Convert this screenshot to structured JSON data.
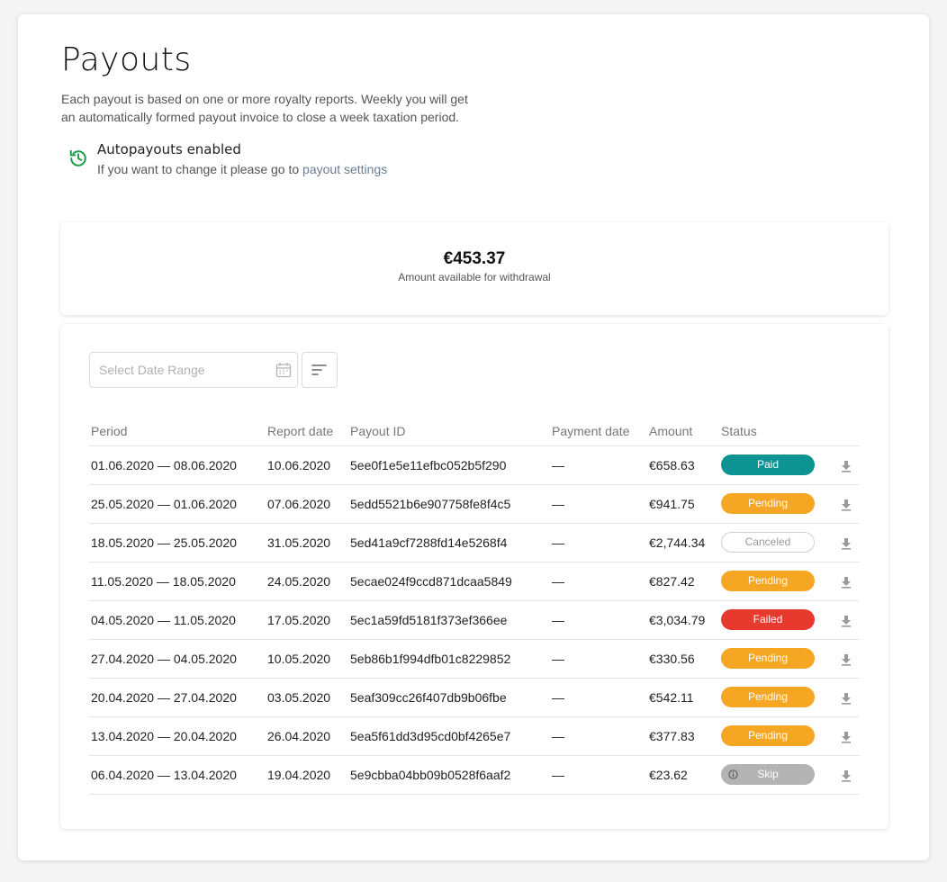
{
  "header": {
    "title": "Payouts",
    "description": "Each payout is based on one or more royalty reports. Weekly you will get an automatically formed payout invoice to close a week taxation period."
  },
  "autopayouts": {
    "icon": "history-icon",
    "title": "Autopayouts enabled",
    "subtitle_prefix": "If you want to change it please go to ",
    "link_label": "payout settings"
  },
  "balance": {
    "amount": "€453.37",
    "label": "Amount available for withdrawal"
  },
  "filters": {
    "date_placeholder": "Select Date Range",
    "calendar_icon": "calendar-icon",
    "sort_icon": "sort-icon"
  },
  "table": {
    "columns": [
      "Period",
      "Report date",
      "Payout ID",
      "Payment date",
      "Amount",
      "Status"
    ],
    "rows": [
      {
        "period": "01.06.2020 — 08.06.2020",
        "report_date": "10.06.2020",
        "payout_id": "5ee0f1e5e11efbc052b5f290",
        "payment_date": "—",
        "amount": "€658.63",
        "status": "Paid",
        "status_type": "paid"
      },
      {
        "period": "25.05.2020 — 01.06.2020",
        "report_date": "07.06.2020",
        "payout_id": "5edd5521b6e907758fe8f4c5",
        "payment_date": "—",
        "amount": "€941.75",
        "status": "Pending",
        "status_type": "pending"
      },
      {
        "period": "18.05.2020 — 25.05.2020",
        "report_date": "31.05.2020",
        "payout_id": "5ed41a9cf7288fd14e5268f4",
        "payment_date": "—",
        "amount": "€2,744.34",
        "status": "Canceled",
        "status_type": "canceled"
      },
      {
        "period": "11.05.2020 — 18.05.2020",
        "report_date": "24.05.2020",
        "payout_id": "5ecae024f9ccd871dcaa5849",
        "payment_date": "—",
        "amount": "€827.42",
        "status": "Pending",
        "status_type": "pending"
      },
      {
        "period": "04.05.2020 — 11.05.2020",
        "report_date": "17.05.2020",
        "payout_id": "5ec1a59fd5181f373ef366ee",
        "payment_date": "—",
        "amount": "€3,034.79",
        "status": "Failed",
        "status_type": "failed"
      },
      {
        "period": "27.04.2020 — 04.05.2020",
        "report_date": "10.05.2020",
        "payout_id": "5eb86b1f994dfb01c8229852",
        "payment_date": "—",
        "amount": "€330.56",
        "status": "Pending",
        "status_type": "pending"
      },
      {
        "period": "20.04.2020 — 27.04.2020",
        "report_date": "03.05.2020",
        "payout_id": "5eaf309cc26f407db9b06fbe",
        "payment_date": "—",
        "amount": "€542.11",
        "status": "Pending",
        "status_type": "pending"
      },
      {
        "period": "13.04.2020 — 20.04.2020",
        "report_date": "26.04.2020",
        "payout_id": "5ea5f61dd3d95cd0bf4265e7",
        "payment_date": "—",
        "amount": "€377.83",
        "status": "Pending",
        "status_type": "pending"
      },
      {
        "period": "06.04.2020 — 13.04.2020",
        "report_date": "19.04.2020",
        "payout_id": "5e9cbba04bb09b0528f6aaf2",
        "payment_date": "—",
        "amount": "€23.62",
        "status": "Skip",
        "status_type": "skip"
      }
    ]
  },
  "colors": {
    "paid": "#0e9393",
    "pending": "#f5a623",
    "failed": "#e8392f",
    "skip": "#b3b3b3",
    "autopayout_icon": "#1e9e4a"
  }
}
